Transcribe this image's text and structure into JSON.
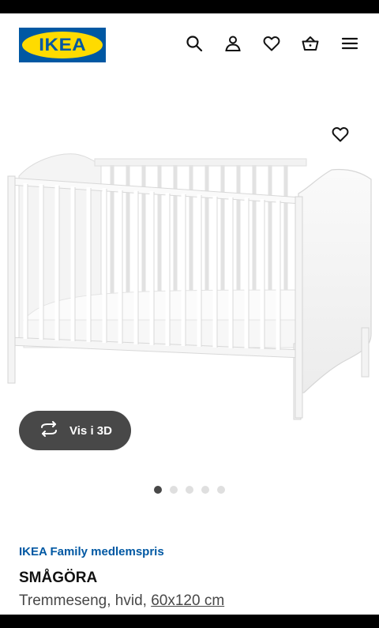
{
  "header": {
    "logo_text": "IKEA",
    "icons": [
      "search-icon",
      "user-icon",
      "heart-icon",
      "basket-icon",
      "menu-icon"
    ]
  },
  "gallery": {
    "view_3d_label": "Vis i 3D",
    "image_count": 5,
    "active_index": 0
  },
  "product": {
    "price_label": "IKEA Family medlemspris",
    "name": "SMÅGÖRA",
    "description": "Tremmeseng, hvid,",
    "size": "60x120 cm"
  },
  "colors": {
    "brand_blue": "#0058a3",
    "brand_yellow": "#ffdb00",
    "button_dark": "#484848"
  }
}
